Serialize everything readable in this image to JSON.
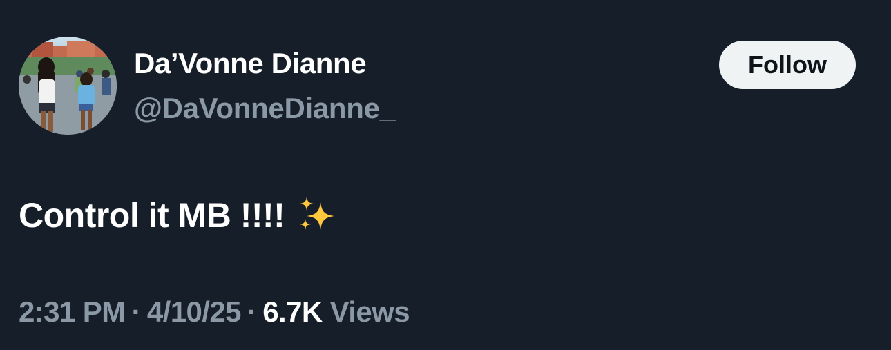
{
  "author": {
    "display_name": "Da’Vonne Dianne",
    "handle": "@DaVonneDianne_"
  },
  "follow_button": {
    "label": "Follow"
  },
  "tweet": {
    "text": "Control it MB !!!!",
    "emoji": "sparkles-emoji"
  },
  "meta": {
    "time": "2:31 PM",
    "separator": "·",
    "date": "4/10/25",
    "views_count": "6.7K",
    "views_label": "Views"
  },
  "colors": {
    "background": "#161f29",
    "primary_text": "#ffffff",
    "secondary_text": "#8b98a5",
    "follow_bg": "#eff3f4",
    "follow_text": "#0f1419"
  }
}
